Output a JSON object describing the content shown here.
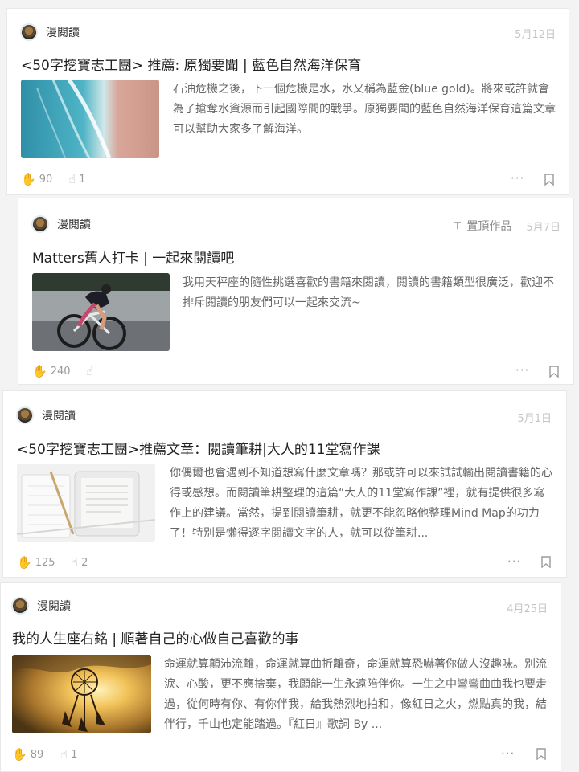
{
  "cards": [
    {
      "author": "漫閱讀",
      "date": "5月12日",
      "title": "<50字挖寶志工團> 推薦: 原獨要聞 | 藍色自然海洋保育",
      "summary": "石油危機之後，下一個危機是水，水又稱為藍金(blue gold)。將來或許就會為了搶奪水資源而引起國際間的戰爭。原獨要聞的藍色自然海洋保育這篇文章可以幫助大家多了解海洋。",
      "appreciations": "90",
      "donations": "1",
      "image": "ocean-beach-image"
    },
    {
      "author": "漫閱讀",
      "date": "5月7日",
      "pinned": "置頂作品",
      "title": "Matters舊人打卡 | 一起來閱讀吧",
      "summary": "我用天秤座的隨性挑選喜歡的書籍來閱讀，閱讀的書籍類型很廣泛，歡迎不排斥閱讀的朋友們可以一起來交流~",
      "appreciations": "240",
      "donations": "",
      "image": "cyclist-image"
    },
    {
      "author": "漫閱讀",
      "date": "5月1日",
      "title": "<50字挖寶志工團>推薦文章：閱讀筆耕|大人的11堂寫作課",
      "summary": "你偶爾也會遇到不知道想寫什麼文章嗎？那或許可以來試試輸出閱讀書籍的心得或感想。而閱讀筆耕整理的這篇“大人的11堂寫作課”裡，就有提供很多寫作上的建議。當然，提到閱讀筆耕，就更不能忽略他整理Mind Map的功力了！特別是懶得逐字閱讀文字的人，就可以從筆耕...",
      "appreciations": "125",
      "donations": "2",
      "image": "ereader-notebook-image"
    },
    {
      "author": "漫閱讀",
      "date": "4月25日",
      "title": "我的人生座右銘 | 順著自己的心做自己喜歡的事",
      "summary": "命運就算顛沛流離，命運就算曲折離奇，命運就算恐嚇著你做人沒趣味。別流淚、心酸，更不應捨棄，我願能一生永遠陪伴你。一生之中彎彎曲曲我也要走過，從何時有你、有你伴我，給我熱烈地拍和，像紅日之火，燃點真的我，結伴行，千山也定能踏過。『紅日』歌詞 By ...",
      "appreciations": "89",
      "donations": "1",
      "image": "dreamcatcher-sunset-image"
    }
  ],
  "icons": {
    "appreciate": "clap-icon",
    "donate": "donate-hand-icon",
    "more": "more-dots-icon",
    "bookmark": "bookmark-icon",
    "pin": "pin-icon"
  },
  "more_label": "···"
}
